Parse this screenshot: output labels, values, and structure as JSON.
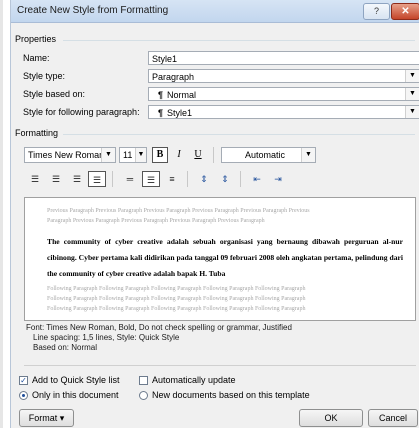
{
  "dialog": {
    "title": "Create New Style from Formatting",
    "help_label": "?",
    "close_label": "✕"
  },
  "properties": {
    "section_label": "Properties",
    "name_label": "Name:",
    "name_value": "Style1",
    "style_type_label": "Style type:",
    "style_type_value": "Paragraph",
    "based_on_label": "Style based on:",
    "based_on_value": "Normal",
    "following_label": "Style for following paragraph:",
    "following_value": "Style1",
    "paragraph_mark": "¶"
  },
  "formatting": {
    "section_label": "Formatting",
    "font_value": "Times New Roman",
    "size_value": "11",
    "bold_label": "B",
    "italic_label": "I",
    "underline_label": "U",
    "color_value": "Automatic",
    "icons": [
      "align-left-icon",
      "align-center-icon",
      "align-right-icon",
      "justify-icon",
      "single-spacing-icon",
      "one-half-spacing-icon",
      "double-spacing-icon",
      "space-before-icon",
      "space-after-icon",
      "decrease-indent-icon",
      "increase-indent-icon"
    ]
  },
  "preview": {
    "previous_lines": [
      "Previous Paragraph Previous Paragraph Previous Paragraph Previous Paragraph Previous Paragraph Previous",
      "Paragraph Previous Paragraph Previous Paragraph Previous Paragraph Previous Paragraph"
    ],
    "main_text": "The community of cyber creative adalah sebuah organisasi yang bernaung dibawah perguruan al-nur cibinong. Cyber pertama kali didirikan pada tanggal 09 februari 2008 oleh angkatan pertama, pelindung dari the community of cyber creative adalah bapak H. Tuba",
    "following_lines": [
      "Following Paragraph Following Paragraph Following Paragraph Following Paragraph Following Paragraph",
      "Following Paragraph Following Paragraph Following Paragraph Following Paragraph Following Paragraph",
      "Following Paragraph Following Paragraph Following Paragraph Following Paragraph Following Paragraph"
    ]
  },
  "description": {
    "line1": "Font: Times New Roman, Bold, Do not check spelling or grammar, Justified",
    "line2": "Line spacing:  1,5 lines, Style: Quick Style",
    "line3": "Based on: Normal"
  },
  "options": {
    "add_quick_style_label": "Add to Quick Style list",
    "add_quick_style_checked": true,
    "auto_update_label": "Automatically update",
    "auto_update_checked": false,
    "only_document_label": "Only in this document",
    "new_documents_label": "New documents based on this template"
  },
  "buttons": {
    "format_label": "Format ▾",
    "ok_label": "OK",
    "cancel_label": "Cancel"
  },
  "colors": {
    "title_bar": "#c2d6ee",
    "close_button": "#c4452a",
    "accent_blue": "#1f4e9a"
  }
}
